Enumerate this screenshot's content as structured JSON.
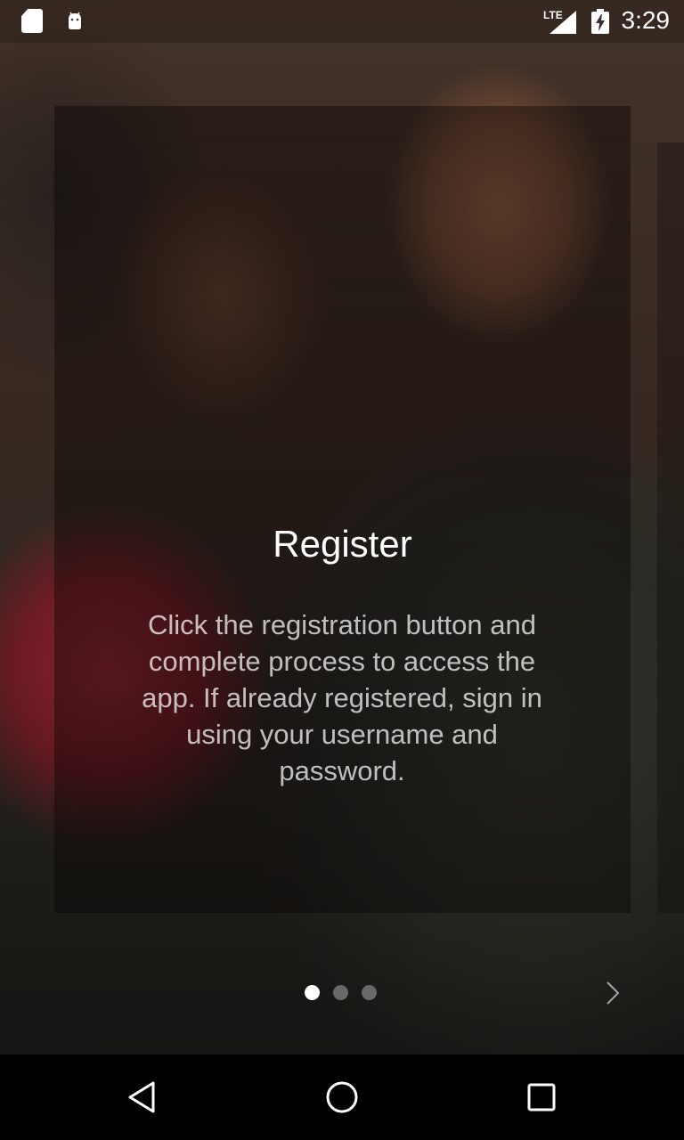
{
  "status_bar": {
    "network_label": "LTE",
    "time": "3:29",
    "icons": [
      "sd-card-icon",
      "android-icon",
      "signal-icon",
      "battery-charging-icon"
    ]
  },
  "slide": {
    "title": "Register",
    "body": "Click the registration button and complete process to access the app. If already registered, sign in using your username and password."
  },
  "pager": {
    "total_pages": 3,
    "current_page": 1,
    "next_icon": "chevron-right-icon"
  },
  "nav_bar": {
    "icons": [
      "back-icon",
      "home-icon",
      "recents-icon"
    ]
  },
  "colors": {
    "title": "#ffffff",
    "body": "#bdb6b3",
    "dot_active": "#ffffff",
    "dot_inactive": "#8a8580",
    "nav_background": "#000000"
  }
}
